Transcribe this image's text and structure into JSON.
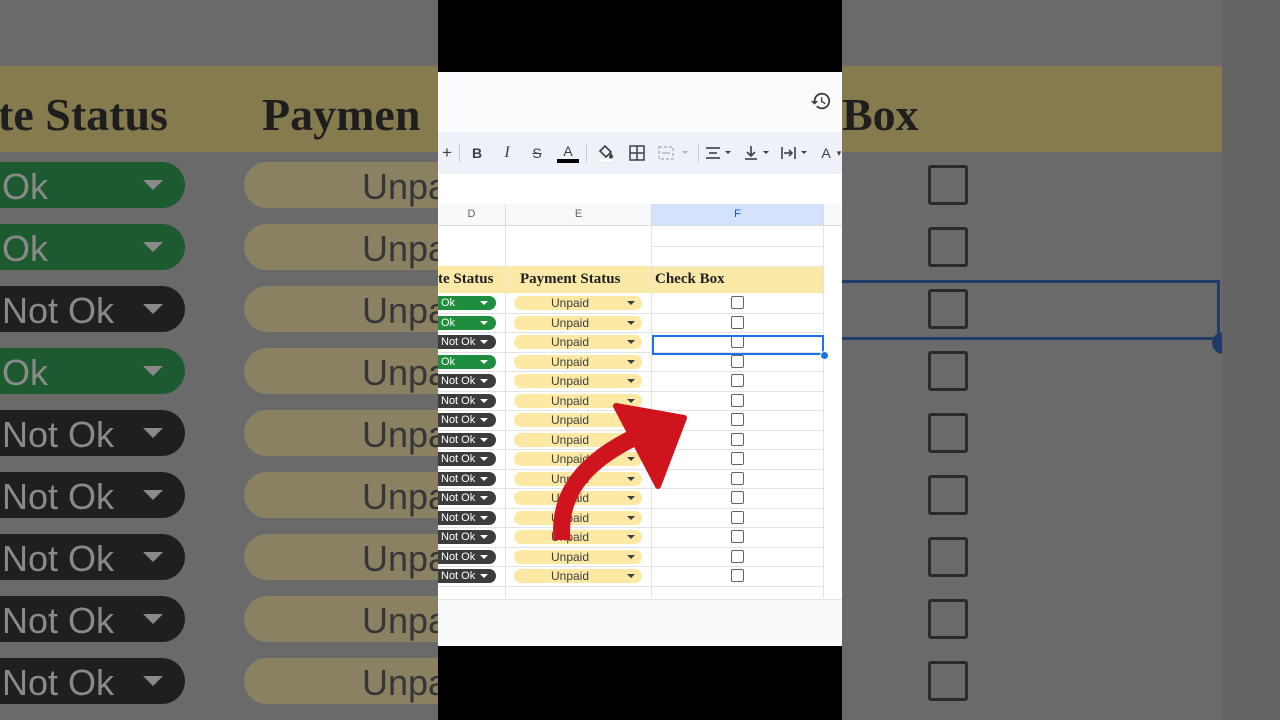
{
  "background": {
    "headers": [
      "te Status",
      "Paymen",
      "Box"
    ],
    "status_rows": [
      "Ok",
      "Ok",
      "Not Ok",
      "Ok",
      "Not Ok",
      "Not Ok",
      "Not Ok",
      "Not Ok",
      "Not Ok"
    ],
    "payment_text": "Unpa"
  },
  "toolbar": {
    "buttons": [
      {
        "name": "add-icon",
        "glyph": "+"
      },
      {
        "name": "bold-button",
        "glyph": "B"
      },
      {
        "name": "italic-button",
        "glyph": "I"
      },
      {
        "name": "strikethrough-button",
        "glyph": "S"
      },
      {
        "name": "text-color-button",
        "glyph": "A"
      },
      {
        "name": "fill-color-button",
        "glyph": "fill"
      },
      {
        "name": "borders-button",
        "glyph": "borders"
      },
      {
        "name": "merge-cells-button",
        "glyph": "merge"
      },
      {
        "name": "horizontal-align-button",
        "glyph": "align"
      },
      {
        "name": "vertical-align-button",
        "glyph": "valign"
      },
      {
        "name": "text-wrap-button",
        "glyph": "wrap"
      },
      {
        "name": "text-rotation-button",
        "glyph": "A"
      }
    ]
  },
  "columns": [
    "D",
    "E",
    "F"
  ],
  "table": {
    "headers": {
      "status": "te Status",
      "payment": "Payment Status",
      "checkbox": "Check Box"
    },
    "rows": [
      {
        "status": "Ok",
        "payment": "Unpaid"
      },
      {
        "status": "Ok",
        "payment": "Unpaid"
      },
      {
        "status": "Not Ok",
        "payment": "Unpaid"
      },
      {
        "status": "Ok",
        "payment": "Unpaid"
      },
      {
        "status": "Not Ok",
        "payment": "Unpaid"
      },
      {
        "status": "Not Ok",
        "payment": "Unpaid"
      },
      {
        "status": "Not Ok",
        "payment": "Unpaid"
      },
      {
        "status": "Not Ok",
        "payment": "Unpaid"
      },
      {
        "status": "Not Ok",
        "payment": "Unpaid"
      },
      {
        "status": "Not Ok",
        "payment": "Unpaid"
      },
      {
        "status": "Not Ok",
        "payment": "Unpaid"
      },
      {
        "status": "Not Ok",
        "payment": "Unpaid"
      },
      {
        "status": "Not Ok",
        "payment": "Unpaid"
      },
      {
        "status": "Not Ok",
        "payment": "Unpaid"
      },
      {
        "status": "Not Ok",
        "payment": "Unpaid"
      }
    ]
  },
  "colors": {
    "ok": "#1e8e3e",
    "not_ok": "#3c3c3c",
    "unpaid": "#fde9a4",
    "header_fill": "#fbe9a8",
    "selection": "#1a73e8",
    "arrow": "#d0141e"
  }
}
